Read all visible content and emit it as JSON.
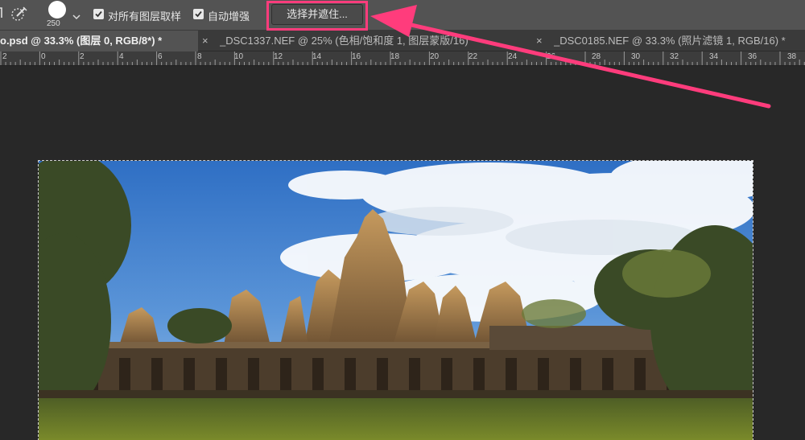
{
  "options_bar": {
    "brush_size": "250",
    "sample_all_layers_label": "对所有图层取样",
    "sample_all_layers_checked": true,
    "auto_enhance_label": "自动增强",
    "auto_enhance_checked": true,
    "select_and_mask_label": "选择并遮住..."
  },
  "tabs": [
    {
      "label": "o.psd @ 33.3% (图层 0, RGB/8*) *",
      "active": true
    },
    {
      "label": "_DSC1337.NEF @ 25% (色相/饱和度 1, 图层蒙版/16) *",
      "active": false
    },
    {
      "label": "_DSC0185.NEF @ 33.3% (照片滤镜 1, RGB/16) *",
      "active": false
    }
  ],
  "tab_close_symbol": "×",
  "ruler": {
    "labels": [
      "2",
      "0",
      "2",
      "4",
      "6",
      "8",
      "10",
      "12",
      "14",
      "16",
      "18",
      "20",
      "22",
      "24",
      "26",
      "28",
      "30",
      "32",
      "34",
      "36",
      "38"
    ]
  },
  "colors": {
    "highlight": "#ff3c7c",
    "workspace": "#282828",
    "options_bar": "#535353"
  },
  "icons": [
    "lasso-brush-icon",
    "quick-selection-icon",
    "chevron-down-icon",
    "checkmark-icon"
  ]
}
